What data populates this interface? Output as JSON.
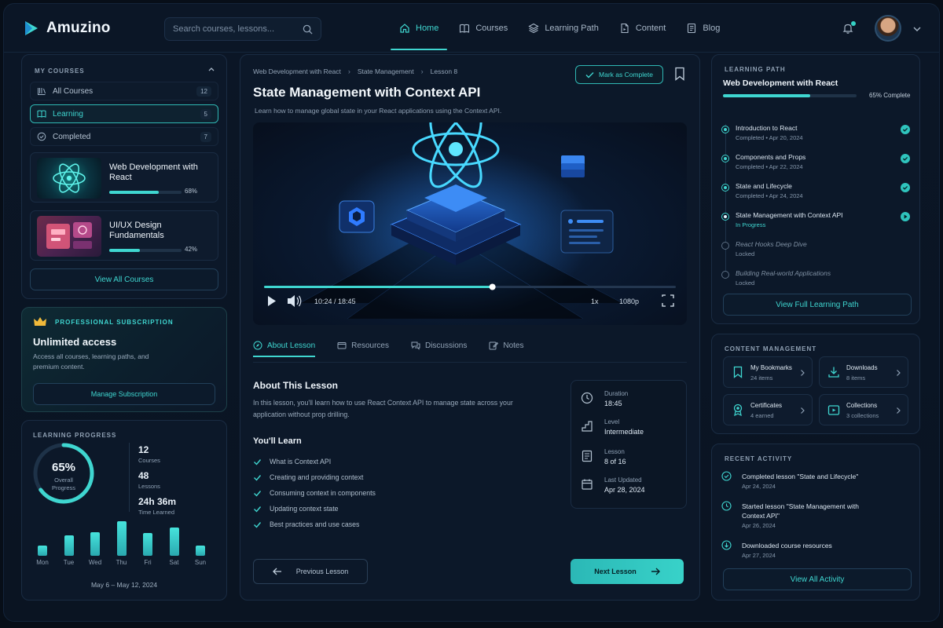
{
  "app": {
    "name": "Amuzino"
  },
  "search": {
    "placeholder": "Search courses, lessons..."
  },
  "nav": [
    {
      "label": "Home",
      "icon": "home-icon",
      "active": true
    },
    {
      "label": "Courses",
      "icon": "book-icon",
      "active": false
    },
    {
      "label": "Learning Path",
      "icon": "layers-icon",
      "active": false
    },
    {
      "label": "Content",
      "icon": "file-icon",
      "active": false
    },
    {
      "label": "Blog",
      "icon": "notebook-icon",
      "active": false
    }
  ],
  "my_courses": {
    "title": "MY COURSES",
    "filters": [
      {
        "label": "All Courses",
        "count": "12",
        "icon": "library-icon"
      },
      {
        "label": "Learning",
        "count": "5",
        "icon": "book-open-icon"
      },
      {
        "label": "Completed",
        "count": "7",
        "icon": "check-circle-icon"
      }
    ],
    "courses": [
      {
        "title": "Web Development with React",
        "progress_pct": 68,
        "progress_label": "68%"
      },
      {
        "title": "UI/UX Design Fundamentals",
        "progress_pct": 42,
        "progress_label": "42%"
      }
    ],
    "view_all": "View All Courses"
  },
  "subscription": {
    "tag": "PROFESSIONAL SUBSCRIPTION",
    "title": "Unlimited access",
    "text": "Access all courses, learning paths, and premium content.",
    "button": "Manage Subscription"
  },
  "progress": {
    "title": "LEARNING PROGRESS",
    "overall_value": "65%",
    "overall_pct": 65,
    "overall_label_1": "Overall",
    "overall_label_2": "Progress",
    "stats": [
      {
        "value": "12",
        "label": "Courses"
      },
      {
        "value": "48",
        "label": "Lessons"
      },
      {
        "value": "24h 36m",
        "label": "Time Learned"
      }
    ],
    "days": [
      "Mon",
      "Tue",
      "Wed",
      "Thu",
      "Fri",
      "Sat",
      "Sun"
    ],
    "day_levels": [
      0.28,
      0.55,
      0.62,
      0.92,
      0.6,
      0.76,
      0.28
    ],
    "range": "May 6 – May 12, 2024"
  },
  "lesson": {
    "breadcrumb": [
      "Web Development with React",
      "State Management",
      "Lesson 8"
    ],
    "title": "State Management with Context API",
    "subtitle": "Learn how to manage global state in your React applications using the Context API.",
    "mark_complete": "Mark as Complete",
    "player": {
      "time": "10:24 / 18:45",
      "played_fraction": 0.5546,
      "speed": "1x",
      "quality": "1080p"
    },
    "tabs": [
      {
        "label": "About Lesson",
        "active": true
      },
      {
        "label": "Resources",
        "active": false
      },
      {
        "label": "Discussions",
        "active": false
      },
      {
        "label": "Notes",
        "active": false
      }
    ],
    "about_title": "About This Lesson",
    "about_text": "In this lesson, you'll learn how to use React Context API to manage state across your application without prop drilling.",
    "learn_title": "You'll Learn",
    "learn_items": [
      "What is Context API",
      "Creating and providing context",
      "Consuming context in components",
      "Updating context state",
      "Best practices and use cases"
    ],
    "meta": [
      {
        "key": "Duration",
        "value": "18:45",
        "icon": "clock-icon"
      },
      {
        "key": "Level",
        "value": "Intermediate",
        "icon": "level-icon"
      },
      {
        "key": "Lesson",
        "value": "8 of 16",
        "icon": "document-icon"
      },
      {
        "key": "Last Updated",
        "value": "Apr 28, 2024",
        "icon": "calendar-icon"
      }
    ],
    "prev": "Previous Lesson",
    "next": "Next Lesson"
  },
  "learning_path": {
    "title": "LEARNING PATH",
    "course": "Web Development with React",
    "progress_pct": 65,
    "progress_label": "65% Complete",
    "steps": [
      {
        "name": "Introduction to React",
        "status": "Completed • Apr 20, 2024",
        "state": "done"
      },
      {
        "name": "Components and Props",
        "status": "Completed • Apr 22, 2024",
        "state": "done"
      },
      {
        "name": "State and Lifecycle",
        "status": "Completed • Apr 24, 2024",
        "state": "done"
      },
      {
        "name": "State Management with Context API",
        "status": "In Progress",
        "state": "current"
      },
      {
        "name": "React Hooks Deep Dive",
        "status": "Locked",
        "state": "locked"
      },
      {
        "name": "Building Real-world Applications",
        "status": "Locked",
        "state": "locked"
      }
    ],
    "button": "View Full Learning Path"
  },
  "content_management": {
    "title": "CONTENT MANAGEMENT",
    "tiles": [
      {
        "title": "My Bookmarks",
        "sub": "24 items",
        "icon": "bookmark-icon"
      },
      {
        "title": "Downloads",
        "sub": "8 items",
        "icon": "download-icon"
      },
      {
        "title": "Certificates",
        "sub": "4 earned",
        "icon": "certificate-icon"
      },
      {
        "title": "Collections",
        "sub": "3 collections",
        "icon": "collection-icon"
      }
    ]
  },
  "recent_activity": {
    "title": "RECENT ACTIVITY",
    "items": [
      {
        "text": "Completed lesson \"State and Lifecycle\"",
        "date": "Apr 24, 2024",
        "icon": "check-circle-icon"
      },
      {
        "text": "Started lesson \"State Management with Context API\"",
        "date": "Apr 26, 2024",
        "icon": "clock-icon"
      },
      {
        "text": "Downloaded course resources",
        "date": "Apr 27, 2024",
        "icon": "download-icon"
      }
    ],
    "button": "View All Activity"
  },
  "colors": {
    "accent": "#3fd6d0",
    "background": "#0a1422",
    "card": "#0c1829"
  }
}
